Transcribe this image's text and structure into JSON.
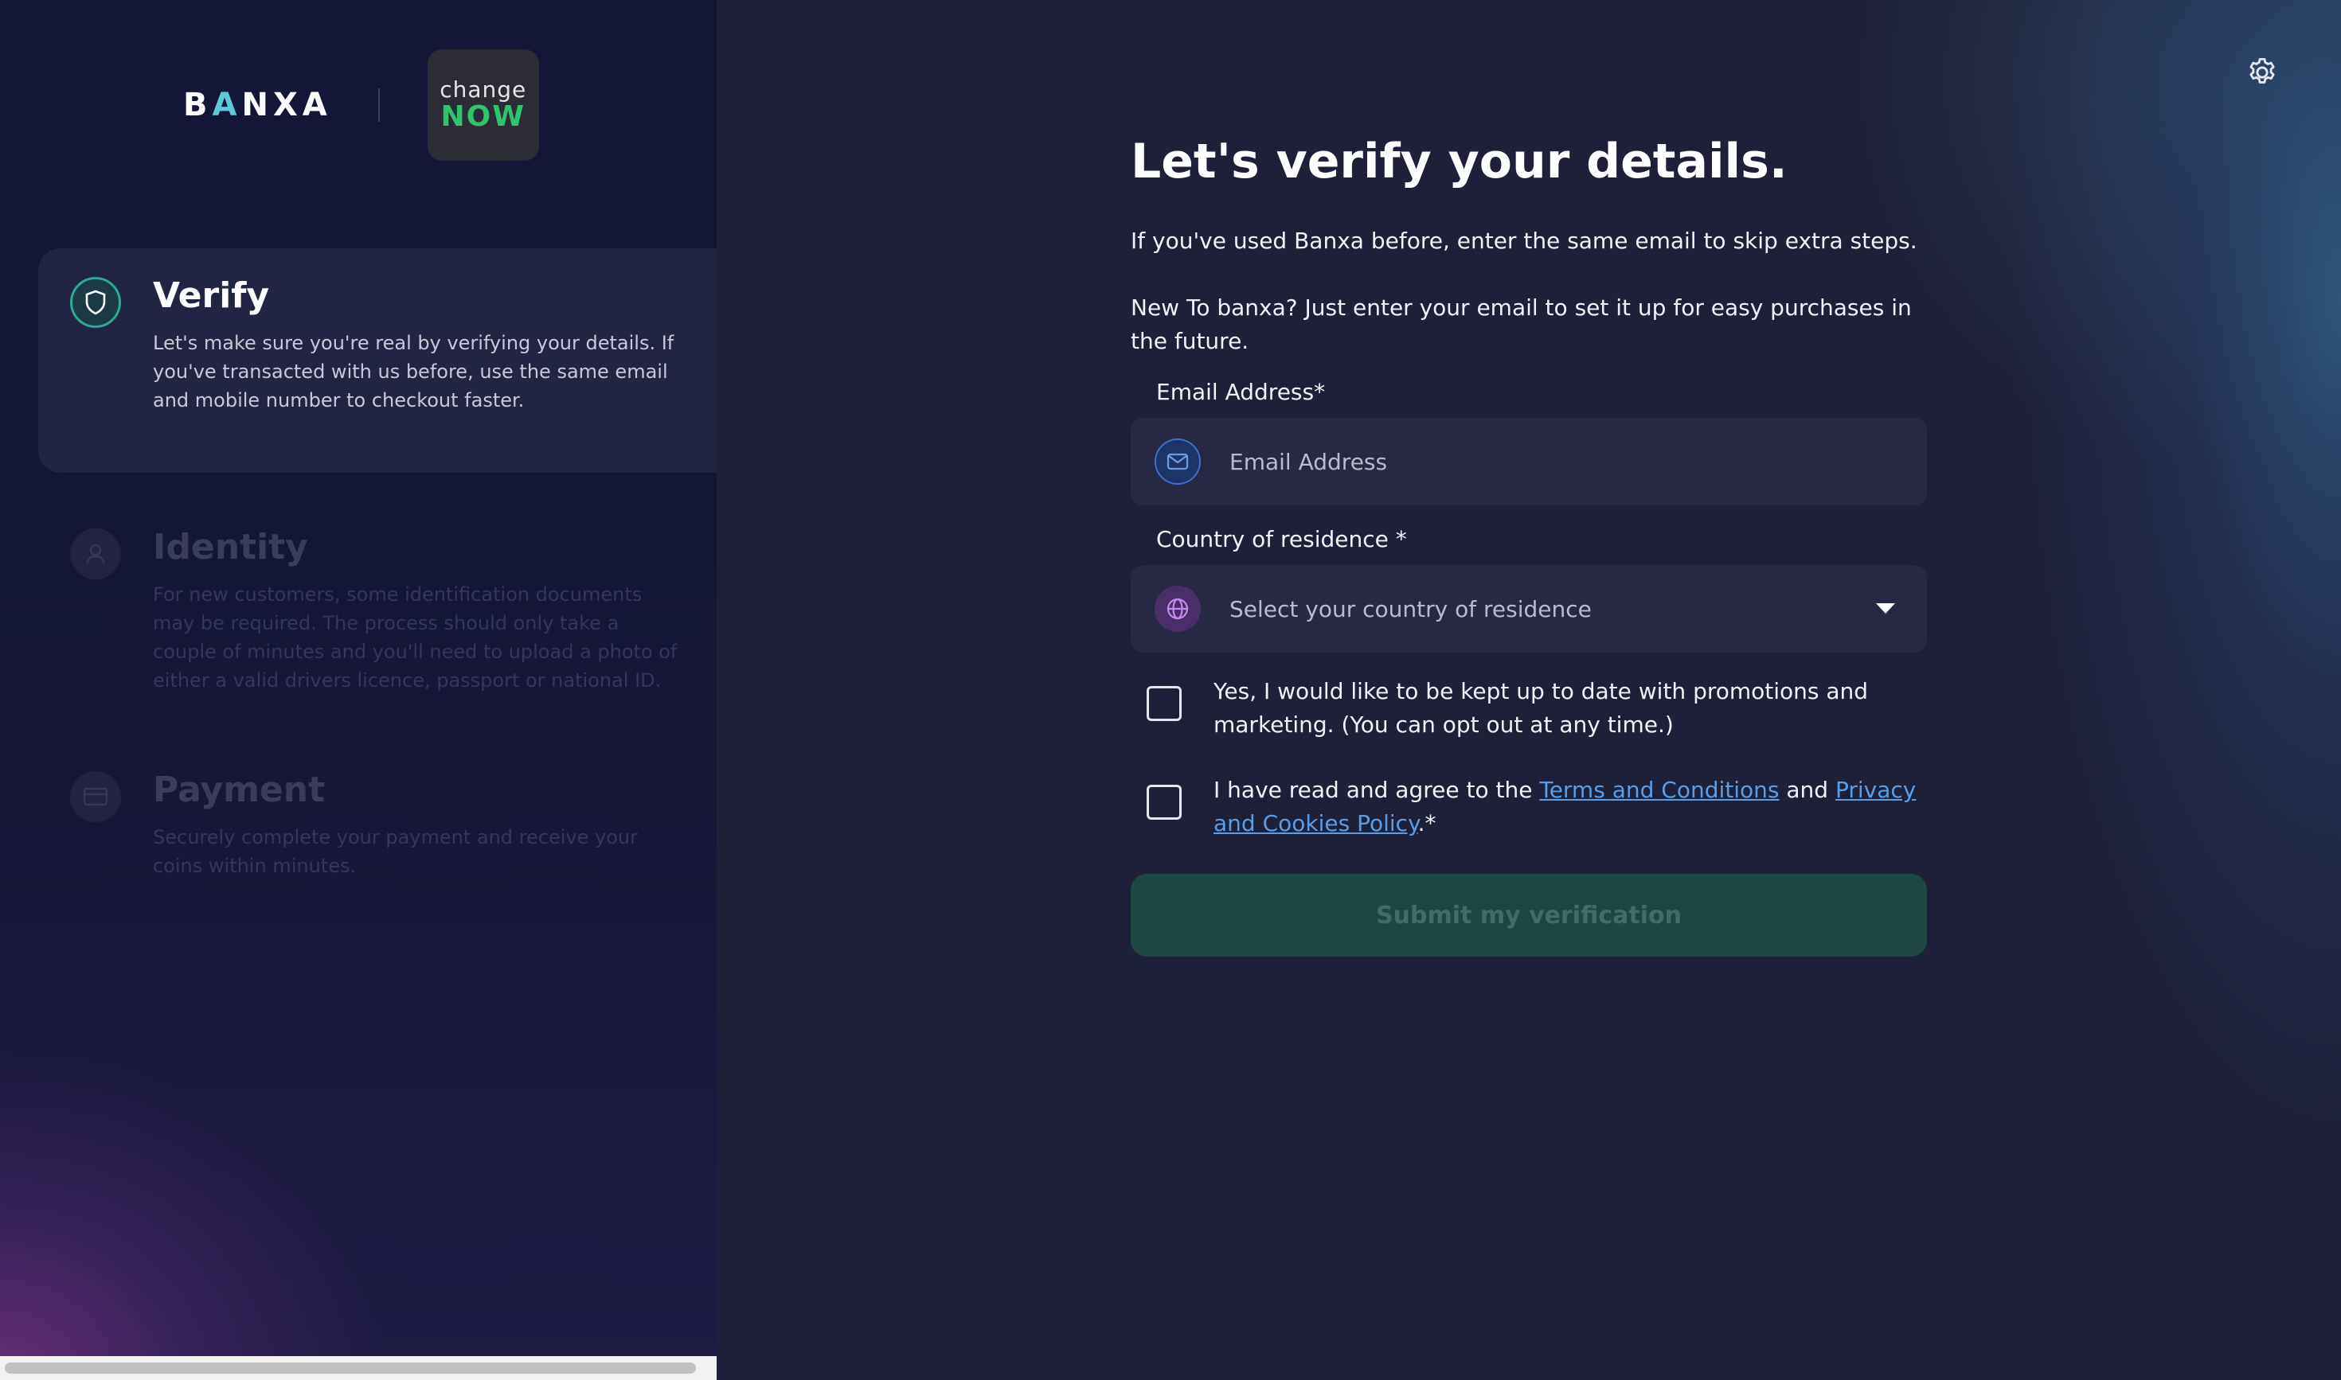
{
  "brand": {
    "banxa_logo": "BANXA",
    "partner_logo_line1": "change",
    "partner_logo_line2": "NOW"
  },
  "steps": [
    {
      "title": "Verify",
      "description": "Let's make sure you're real by verifying your details. If you've transacted with us before, use the same email and mobile number to checkout faster.",
      "icon": "shield-icon",
      "state": "active"
    },
    {
      "title": "Identity",
      "description": "For new customers, some identification documents may be required. The process should only take a couple of minutes and you'll need to upload a photo of either a valid drivers licence, passport or national ID.",
      "icon": "user-icon",
      "state": "inactive"
    },
    {
      "title": "Payment",
      "description": "Securely complete your payment and receive your coins within minutes.",
      "icon": "card-icon",
      "state": "inactive"
    }
  ],
  "form": {
    "title": "Let's verify your details.",
    "intro1": "If you've used Banxa before, enter the same email to skip extra steps.",
    "intro2": "New To banxa? Just enter your email to set it up for easy purchases in the future.",
    "email_label": "Email Address*",
    "email_placeholder": "Email Address",
    "country_label": "Country of residence *",
    "country_placeholder": "Select your country of residence",
    "marketing_text": "Yes, I would like to be kept up to date with promotions and marketing. (You can opt out at any time.)",
    "terms_prefix": "I have read and agree to the ",
    "terms_link": "Terms and Conditions",
    "terms_and": " and ",
    "privacy_link": "Privacy and Cookies Policy",
    "terms_suffix": ".*",
    "submit_label": "Submit my verification"
  },
  "colors": {
    "accent_teal": "#2ea897",
    "link_blue": "#5a9de8",
    "submit_disabled_bg": "#1f4741"
  }
}
